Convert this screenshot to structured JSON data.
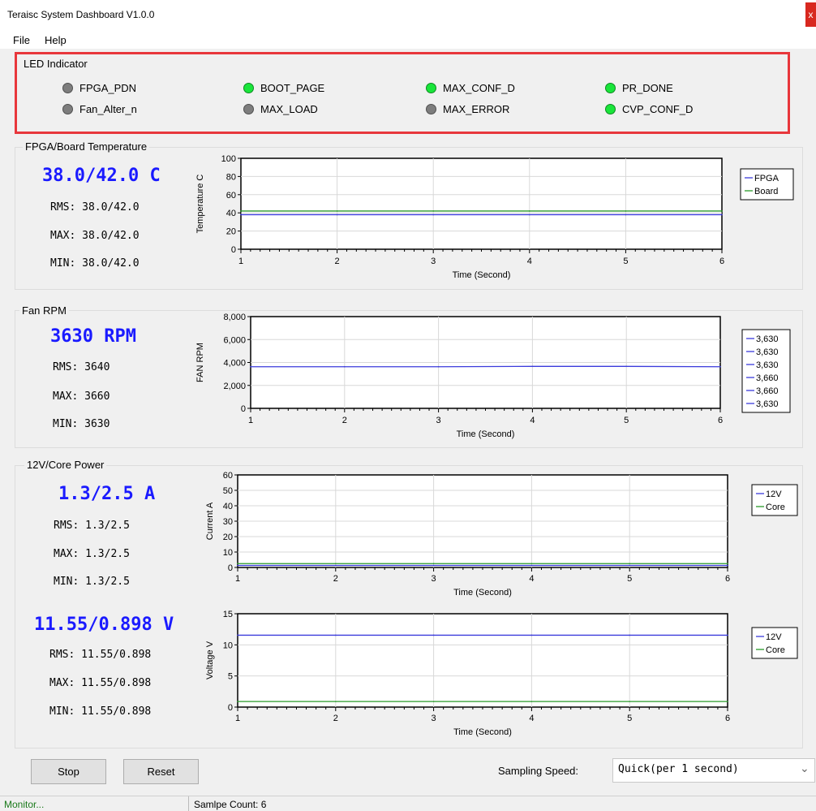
{
  "window": {
    "title": "Teraisc System Dashboard V1.0.0",
    "close_glyph": "x"
  },
  "menu": {
    "file": "File",
    "help": "Help"
  },
  "led": {
    "title": "LED Indicator",
    "items": [
      {
        "label": "FPGA_PDN",
        "state": "off"
      },
      {
        "label": "BOOT_PAGE",
        "state": "on"
      },
      {
        "label": "MAX_CONF_D",
        "state": "on"
      },
      {
        "label": "PR_DONE",
        "state": "on"
      },
      {
        "label": "Fan_Alter_n",
        "state": "off"
      },
      {
        "label": "MAX_LOAD",
        "state": "off"
      },
      {
        "label": "MAX_ERROR",
        "state": "off"
      },
      {
        "label": "CVP_CONF_D",
        "state": "on"
      }
    ],
    "colors": {
      "on": "#19e53a",
      "off": "#7d7d7d"
    }
  },
  "temperature": {
    "group": "FPGA/Board Temperature",
    "current": "38.0/42.0 C",
    "rms": "RMS: 38.0/42.0",
    "max": "MAX: 38.0/42.0",
    "min": "MIN: 38.0/42.0"
  },
  "fan": {
    "group": "Fan RPM",
    "current": "3630 RPM",
    "rms": "RMS: 3640",
    "max": "MAX: 3660",
    "min": "MIN: 3630"
  },
  "power": {
    "group": "12V/Core Power",
    "current": "1.3/2.5 A",
    "rms": "RMS: 1.3/2.5",
    "max": "MAX: 1.3/2.5",
    "min": "MIN: 1.3/2.5"
  },
  "voltage": {
    "current": "11.55/0.898 V",
    "rms": "RMS: 11.55/0.898",
    "max": "MAX: 11.55/0.898",
    "min": "MIN: 11.55/0.898"
  },
  "controls": {
    "stop": "Stop",
    "reset": "Reset",
    "sampling_label": "Sampling Speed:",
    "sampling_value": "Quick(per 1 second)"
  },
  "status": {
    "left": "Monitor...",
    "count": "Samlpe Count: 6"
  },
  "chart_data": [
    {
      "id": "temp",
      "type": "line",
      "xlabel": "Time (Second)",
      "ylabel": "Temperature C",
      "xlim": [
        1,
        6
      ],
      "ylim": [
        0,
        100
      ],
      "xticks": [
        "1",
        "2",
        "3",
        "4",
        "5",
        "6"
      ],
      "yticks": [
        "0",
        "20",
        "40",
        "60",
        "80",
        "100"
      ],
      "grid": true,
      "legend_placement": "right",
      "series": [
        {
          "name": "FPGA",
          "color": "#3b3bdc",
          "x": [
            1,
            2,
            3,
            4,
            5,
            6
          ],
          "y": [
            38,
            38,
            38,
            38,
            38,
            38
          ]
        },
        {
          "name": "Board",
          "color": "#2a9a2a",
          "x": [
            1,
            2,
            3,
            4,
            5,
            6
          ],
          "y": [
            42,
            42,
            42,
            42,
            42,
            42
          ]
        }
      ]
    },
    {
      "id": "fan",
      "type": "line",
      "xlabel": "Time (Second)",
      "ylabel": "FAN RPM",
      "xlim": [
        1,
        6
      ],
      "ylim": [
        0,
        8000
      ],
      "xticks": [
        "1",
        "2",
        "3",
        "4",
        "5",
        "6"
      ],
      "yticks": [
        "0",
        "2,000",
        "4,000",
        "6,000",
        "8,000"
      ],
      "grid": true,
      "legend_placement": "right",
      "legend_entries": [
        "3,630",
        "3,630",
        "3,630",
        "3,660",
        "3,660",
        "3,630"
      ],
      "series": [
        {
          "color": "#3b3bdc",
          "x": [
            1,
            2,
            3,
            4,
            5,
            6
          ],
          "y": [
            3630,
            3630,
            3630,
            3660,
            3660,
            3630
          ]
        }
      ]
    },
    {
      "id": "current",
      "type": "line",
      "xlabel": "Time (Second)",
      "ylabel": "Current A",
      "xlim": [
        1,
        6
      ],
      "ylim": [
        0,
        60
      ],
      "xticks": [
        "1",
        "2",
        "3",
        "4",
        "5",
        "6"
      ],
      "yticks": [
        "0",
        "10",
        "20",
        "30",
        "40",
        "50",
        "60"
      ],
      "grid": true,
      "legend_placement": "right",
      "series": [
        {
          "name": "12V",
          "color": "#3b3bdc",
          "x": [
            1,
            2,
            3,
            4,
            5,
            6
          ],
          "y": [
            1.3,
            1.3,
            1.3,
            1.3,
            1.3,
            1.3
          ]
        },
        {
          "name": "Core",
          "color": "#2a9a2a",
          "x": [
            1,
            2,
            3,
            4,
            5,
            6
          ],
          "y": [
            2.5,
            2.5,
            2.5,
            2.5,
            2.5,
            2.5
          ]
        }
      ]
    },
    {
      "id": "voltage",
      "type": "line",
      "xlabel": "Time (Second)",
      "ylabel": "Voltage V",
      "xlim": [
        1,
        6
      ],
      "ylim": [
        0,
        15
      ],
      "xticks": [
        "1",
        "2",
        "3",
        "4",
        "5",
        "6"
      ],
      "yticks": [
        "0",
        "5",
        "10",
        "15"
      ],
      "grid": true,
      "legend_placement": "right",
      "series": [
        {
          "name": "12V",
          "color": "#3b3bdc",
          "x": [
            1,
            2,
            3,
            4,
            5,
            6
          ],
          "y": [
            11.55,
            11.55,
            11.55,
            11.55,
            11.55,
            11.55
          ]
        },
        {
          "name": "Core",
          "color": "#2a9a2a",
          "x": [
            1,
            2,
            3,
            4,
            5,
            6
          ],
          "y": [
            0.898,
            0.898,
            0.898,
            0.898,
            0.898,
            0.898
          ]
        }
      ]
    }
  ]
}
